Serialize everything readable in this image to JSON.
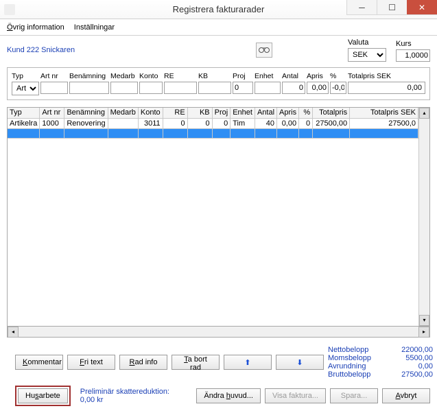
{
  "window": {
    "title": "Registrera fakturarader"
  },
  "menu": {
    "ovrig": "Övrig information",
    "installningar": "Inställningar"
  },
  "customer": "Kund 222 Snickaren",
  "valuta": {
    "label": "Valuta",
    "value": "SEK"
  },
  "kurs": {
    "label": "Kurs",
    "value": "1,0000"
  },
  "entry": {
    "headers": {
      "typ": "Typ",
      "artnr": "Art nr",
      "benamning": "Benämning",
      "medarb": "Medarb",
      "konto": "Konto",
      "re": "RE",
      "kb": "KB",
      "proj": "Proj",
      "enhet": "Enhet",
      "antal": "Antal",
      "apris": "Apris",
      "pct": "%",
      "totalpris": "Totalpris SEK"
    },
    "values": {
      "typ": "Arti",
      "artnr": "",
      "benamning": "",
      "medarb": "",
      "konto": "",
      "re": "",
      "kb": "",
      "proj": "0",
      "enhet": "",
      "antal": "0",
      "apris": "0,00",
      "pct": "-0,0",
      "totalpris": "0,00"
    }
  },
  "grid": {
    "headers": [
      "Typ",
      "Art nr",
      "Benämning",
      "Medarb",
      "Konto",
      "RE",
      "KB",
      "Proj",
      "Enhet",
      "Antal",
      "Apris",
      "%",
      "Totalpris",
      "Totalpris SEK"
    ],
    "rows": [
      {
        "typ": "Artikelra",
        "artnr": "1000",
        "benamning": "Renovering",
        "medarb": "",
        "konto": "3011",
        "re": "0",
        "kb": "0",
        "proj": "0",
        "enhet": "Tim",
        "antal": "40",
        "apris": "0,00",
        "pct": "0",
        "totalpris": "27500,00",
        "totalprissek": "27500,0"
      }
    ]
  },
  "buttons": {
    "kommentar": "Kommentar",
    "fritext": "Fri text",
    "radinfo": "Rad info",
    "tabortrad": "Ta bort rad",
    "husarbete": "Husarbete",
    "andrahuvud": "Ändra huvud...",
    "visafaktura": "Visa faktura...",
    "spara": "Spara...",
    "avbryt": "Avbryt"
  },
  "summary": {
    "netto": {
      "label": "Nettobelopp",
      "value": "22000,00"
    },
    "moms": {
      "label": "Momsbelopp",
      "value": "5500,00"
    },
    "avrund": {
      "label": "Avrundning",
      "value": "0,00"
    },
    "brutto": {
      "label": "Bruttobelopp",
      "value": "27500,00"
    }
  },
  "prelim": {
    "label": "Preliminär skattereduktion:",
    "value": "0,00 kr"
  }
}
